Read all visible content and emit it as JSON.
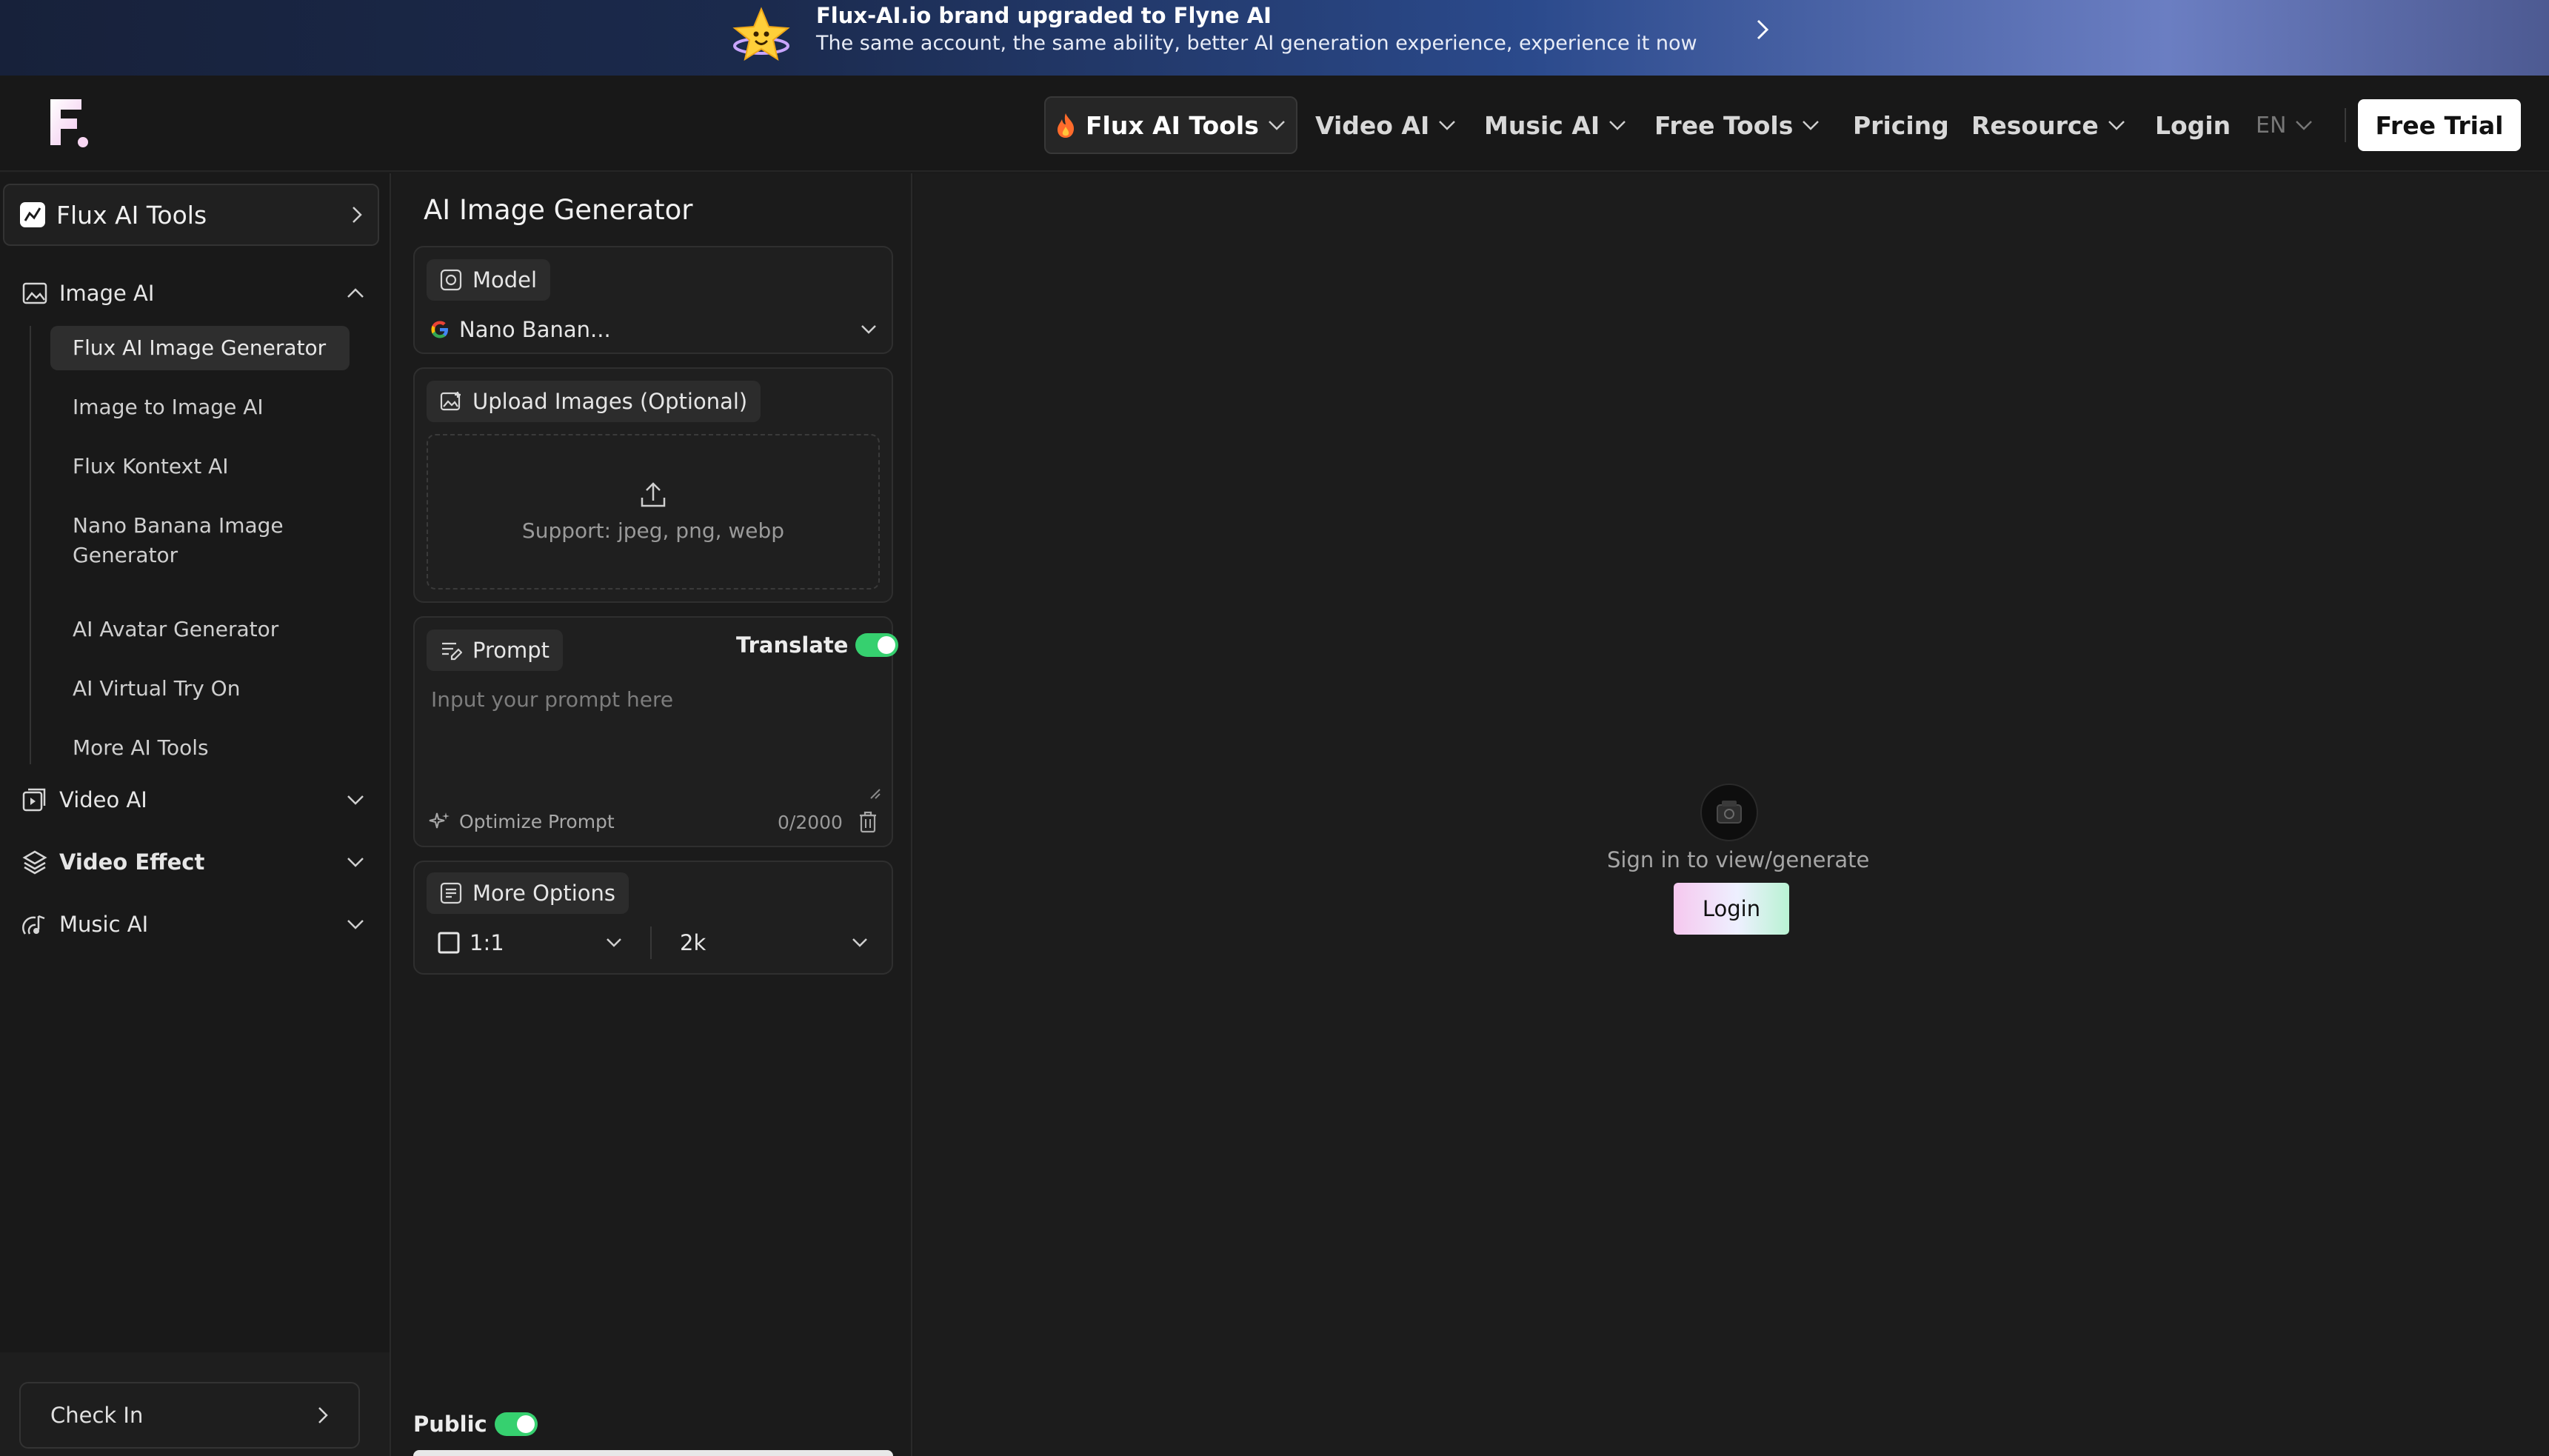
{
  "banner": {
    "line1": "Flux-AI.io brand upgraded to Flyne AI",
    "line2": "The same account, the same ability, better AI generation experience, experience it now"
  },
  "header": {
    "nav": [
      {
        "label": "Flux AI Tools",
        "active": true
      },
      {
        "label": "Video AI"
      },
      {
        "label": "Music AI"
      },
      {
        "label": "Free Tools"
      },
      {
        "label": "Pricing"
      },
      {
        "label": "Resource"
      },
      {
        "label": "Login"
      },
      {
        "label": "EN"
      }
    ],
    "free_trial": "Free Trial"
  },
  "sidebar": {
    "top": "Flux AI Tools",
    "image_ai": "Image AI",
    "image_items": [
      "Flux AI Image Generator",
      "Image to Image AI",
      "Flux Kontext AI",
      "Nano Banana Image Generator",
      "AI Avatar Generator",
      "AI Virtual Try On",
      "More AI Tools"
    ],
    "video_ai": "Video AI",
    "video_effect": "Video Effect",
    "music_ai": "Music AI",
    "check_in": "Check In"
  },
  "form": {
    "title": "AI Image Generator",
    "model_label": "Model",
    "model_value": "Nano Banan...",
    "upload_label": "Upload Images (Optional)",
    "upload_support": "Support: jpeg, png, webp",
    "prompt_label": "Prompt",
    "translate_label": "Translate",
    "translate_on": true,
    "prompt_placeholder": "Input your prompt here",
    "optimize_label": "Optimize Prompt",
    "counter": "0/2000",
    "more_options": "More Options",
    "aspect_ratio": "1:1",
    "resolution": "2k",
    "public_label": "Public",
    "public_on": true
  },
  "preview": {
    "message": "Sign in to view/generate",
    "login": "Login"
  },
  "colors": {
    "accent_green": "#36d06f",
    "background": "#1a1a1a"
  }
}
